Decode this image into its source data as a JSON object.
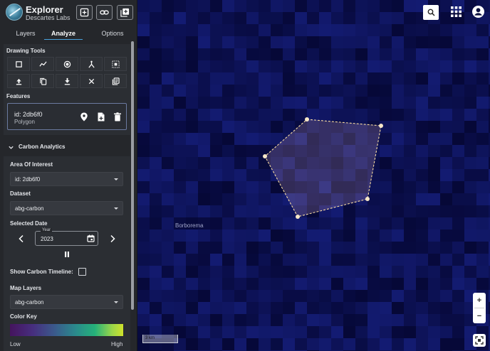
{
  "app": {
    "title": "Explorer",
    "subtitle": "Descartes Labs"
  },
  "header_buttons": [
    "add-box-icon",
    "link-icon",
    "library-add-icon"
  ],
  "tabs": [
    {
      "label": "Layers",
      "active": false
    },
    {
      "label": "Analyze",
      "active": true
    },
    {
      "label": "Options",
      "active": false
    }
  ],
  "drawing_tools": {
    "title": "Drawing Tools",
    "row1": [
      "rectangle-icon",
      "polyline-icon",
      "circle-icon",
      "branch-icon",
      "select-area-icon"
    ],
    "row2": [
      "upload-icon",
      "copy-icon",
      "download-icon",
      "close-icon",
      "library-books-icon"
    ]
  },
  "features": {
    "title": "Features",
    "item": {
      "id": "id: 2db6f0",
      "type": "Polygon"
    }
  },
  "carbon": {
    "title": "Carbon Analytics",
    "area_label": "Area Of Interest",
    "area_value": "id: 2db6f0",
    "dataset_label": "Dataset",
    "dataset_value": "abg-carbon",
    "date_label": "Selected Date",
    "year_label": "Year",
    "year_value": "2023",
    "timeline_label": "Show Carbon Timeline:",
    "timeline_checked": false,
    "map_layers_label": "Map Layers",
    "map_layers_value": "abg-carbon",
    "color_key_label": "Color Key",
    "key_low": "Low",
    "key_high": "High"
  },
  "map": {
    "place": "Borborema",
    "scale_text": "3 km",
    "zoom_in": "+",
    "zoom_out": "−"
  },
  "colors": {
    "accent": "#4aa3df",
    "polygon_stroke": "#f5d9a0",
    "sidebar_bg": "#25272b"
  }
}
